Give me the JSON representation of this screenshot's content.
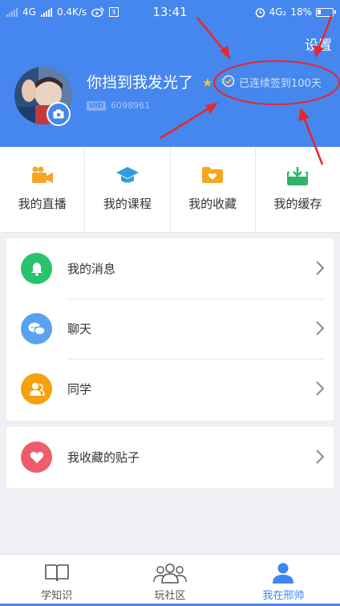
{
  "status_bar": {
    "network": "4G",
    "speed": "0.4K/s",
    "time": "13:41",
    "network2": "4G₂",
    "battery": "18%"
  },
  "header": {
    "settings_label": "设置",
    "username": "你挡到我发光了",
    "checkin_text": "已连续签到100天",
    "uid_tag": "UID",
    "uid_value": "6098961"
  },
  "grid": [
    {
      "label": "我的直播",
      "icon": "video-camera-icon",
      "color": "#f5a623"
    },
    {
      "label": "我的课程",
      "icon": "graduation-cap-icon",
      "color": "#2f9be0"
    },
    {
      "label": "我的收藏",
      "icon": "folder-heart-icon",
      "color": "#f5a623"
    },
    {
      "label": "我的缓存",
      "icon": "download-tray-icon",
      "color": "#2db46a"
    }
  ],
  "list": [
    {
      "label": "我的消息",
      "icon": "bell-icon",
      "color": "#27c46d"
    },
    {
      "label": "聊天",
      "icon": "chat-bubbles-icon",
      "color": "#5aa2f0"
    },
    {
      "label": "同学",
      "icon": "classmates-icon",
      "color": "#f5a20f"
    }
  ],
  "favorites": {
    "label": "我收藏的贴子",
    "icon": "heart-icon",
    "color": "#ef5d6a"
  },
  "tabs": [
    {
      "label": "学知识",
      "icon": "book-icon",
      "active": false
    },
    {
      "label": "玩社区",
      "icon": "community-icon",
      "active": false
    },
    {
      "label": "我在邢帅",
      "icon": "person-icon",
      "active": true
    }
  ],
  "colors": {
    "brand_blue": "#4587ee",
    "annotation_red": "#e8262d"
  }
}
